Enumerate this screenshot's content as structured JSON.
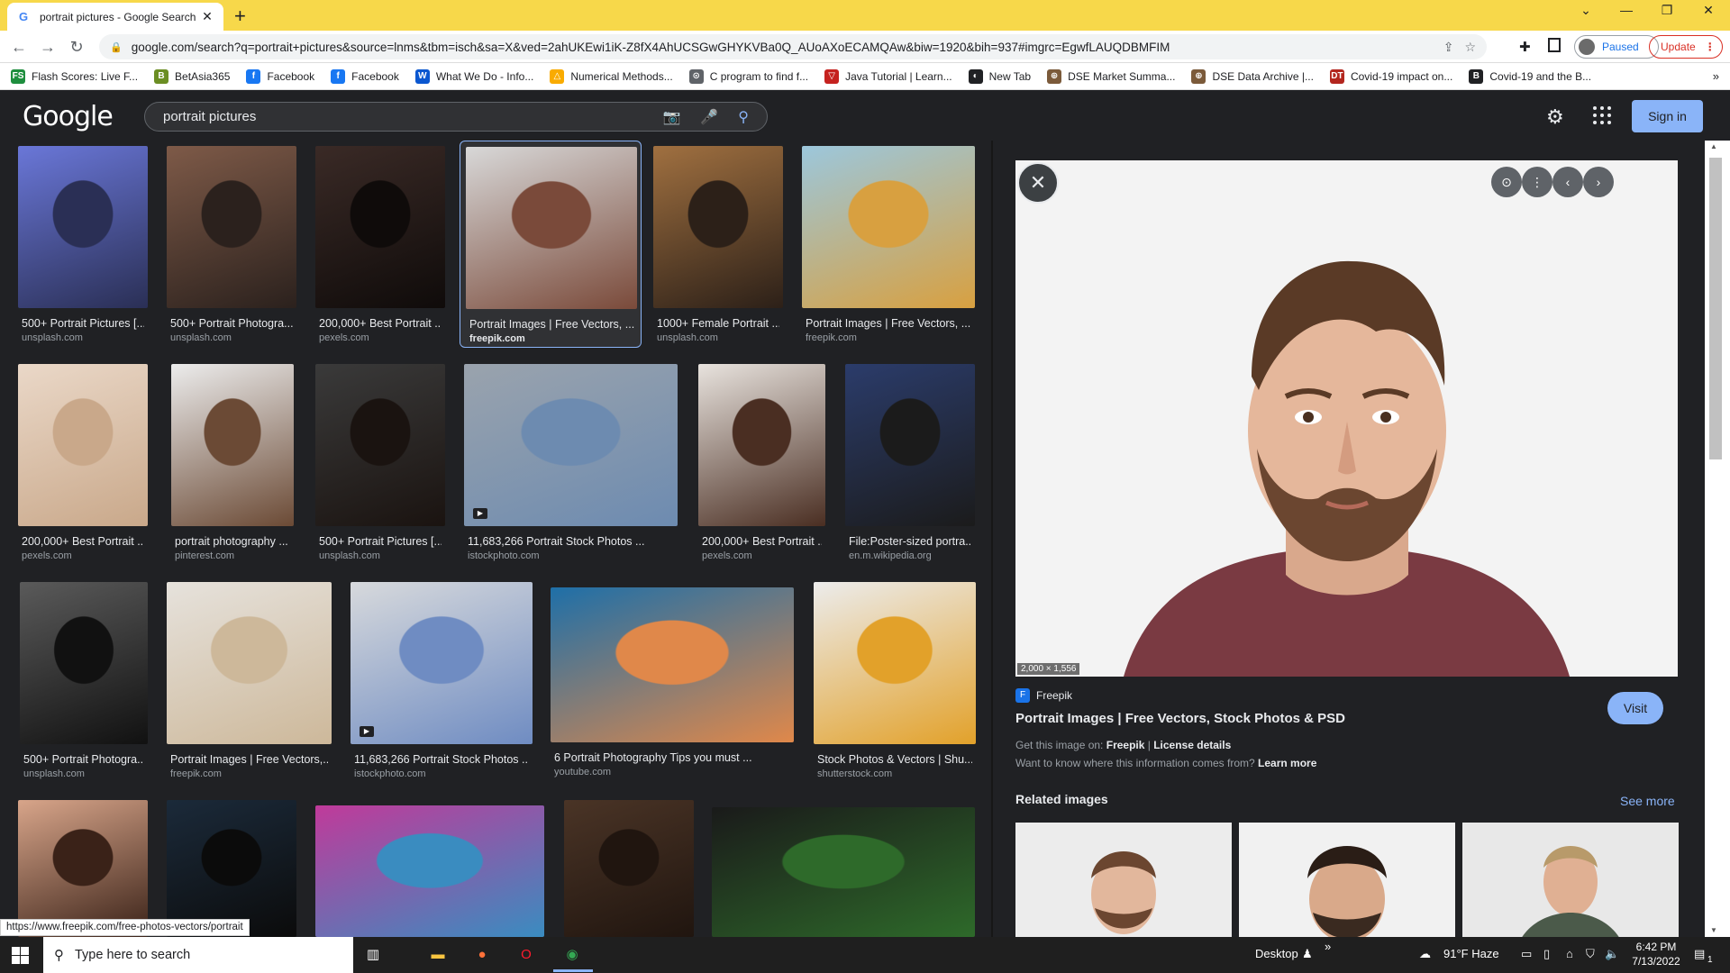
{
  "browser": {
    "tab_title": "portrait pictures - Google Search",
    "tab_favicon": "G",
    "url": "google.com/search?q=portrait+pictures&source=lnms&tbm=isch&sa=X&ved=2ahUKEwi1iK-Z8fX4AhUCSGwGHYKVBa0Q_AUoAXoECAMQAw&biw=1920&bih=937#imgrc=EgwfLAUQDBMFIM",
    "profile_label": "Paused",
    "update_label": "Update",
    "tabbar_color": "#f7d84a",
    "bookmarks": [
      {
        "label": "Flash Scores: Live F...",
        "icon": "FS",
        "color": "#1e8e3e"
      },
      {
        "label": "BetAsia365",
        "icon": "B",
        "color": "#6b8e23"
      },
      {
        "label": "Facebook",
        "icon": "f",
        "color": "#1877f2"
      },
      {
        "label": "Facebook",
        "icon": "f",
        "color": "#1877f2"
      },
      {
        "label": "What We Do - Info...",
        "icon": "W",
        "color": "#0b57d0"
      },
      {
        "label": "Numerical Methods...",
        "icon": "△",
        "color": "#f9ab00"
      },
      {
        "label": "C program to find f...",
        "icon": "⊙",
        "color": "#5f6368"
      },
      {
        "label": "Java Tutorial | Learn...",
        "icon": "▽",
        "color": "#c5221f"
      },
      {
        "label": "New Tab",
        "icon": "◐",
        "color": "#202124"
      },
      {
        "label": "DSE Market Summa...",
        "icon": "⊕",
        "color": "#7b5a3a"
      },
      {
        "label": "DSE Data Archive |...",
        "icon": "⊕",
        "color": "#7b5a3a"
      },
      {
        "label": "Covid-19 impact on...",
        "icon": "DT",
        "color": "#b3261e"
      },
      {
        "label": "Covid-19 and the B...",
        "icon": "B",
        "color": "#202124"
      }
    ]
  },
  "google": {
    "logo": "Google",
    "query": "portrait pictures",
    "signin_label": "Sign in",
    "results": [
      {
        "title": "500+ Portrait Pictures [...",
        "source": "unsplash.com",
        "colors": [
          "#6a77d8",
          "#2a2f55"
        ]
      },
      {
        "title": "500+ Portrait Photogra...",
        "source": "unsplash.com",
        "colors": [
          "#7e5a48",
          "#2b211d"
        ]
      },
      {
        "title": "200,000+ Best Portrait ...",
        "source": "pexels.com",
        "colors": [
          "#3a2a26",
          "#0f0b0a"
        ]
      },
      {
        "title": "Portrait Images | Free Vectors, ...",
        "source": "freepik.com",
        "colors": [
          "#d8d8d8",
          "#7a4a3a"
        ],
        "selected": true
      },
      {
        "title": "1000+ Female Portrait ...",
        "source": "unsplash.com",
        "colors": [
          "#a07040",
          "#2c2018"
        ]
      },
      {
        "title": "Portrait Images | Free Vectors, ...",
        "source": "freepik.com",
        "colors": [
          "#9cc7dc",
          "#d8a040"
        ]
      },
      {
        "title": "200,000+ Best Portrait ...",
        "source": "pexels.com",
        "colors": [
          "#ead8c8",
          "#c9a88a"
        ]
      },
      {
        "title": "portrait photography ...",
        "source": "pinterest.com",
        "colors": [
          "#ececec",
          "#6b4a35"
        ]
      },
      {
        "title": "500+ Portrait Pictures [...",
        "source": "unsplash.com",
        "colors": [
          "#3a3a3a",
          "#1a1310"
        ]
      },
      {
        "title": "11,683,266 Portrait Stock Photos ...",
        "source": "istockphoto.com",
        "colors": [
          "#9aa3ad",
          "#6d8bb0"
        ],
        "video": true
      },
      {
        "title": "200,000+ Best Portrait ...",
        "source": "pexels.com",
        "colors": [
          "#e8e3de",
          "#4a2e22"
        ]
      },
      {
        "title": "File:Poster-sized portra...",
        "source": "en.m.wikipedia.org",
        "colors": [
          "#2b3c6b",
          "#1b1b1b"
        ]
      },
      {
        "title": "500+ Portrait Photogra...",
        "source": "unsplash.com",
        "colors": [
          "#5a5a5a",
          "#111111"
        ]
      },
      {
        "title": "Portrait Images | Free Vectors,...",
        "source": "freepik.com",
        "colors": [
          "#e6e2dc",
          "#cdb89a"
        ]
      },
      {
        "title": "11,683,266 Portrait Stock Photos ...",
        "source": "istockphoto.com",
        "colors": [
          "#d7d9dc",
          "#6f8cc2"
        ],
        "video": true
      },
      {
        "title": "6 Portrait Photography Tips you must ...",
        "source": "youtube.com",
        "colors": [
          "#1e6fa8",
          "#e0884a"
        ]
      },
      {
        "title": "Stock Photos & Vectors | Shu...",
        "source": "shutterstock.com",
        "colors": [
          "#ececec",
          "#e2a12a"
        ]
      },
      {
        "title": "",
        "source": "",
        "colors": [
          "#d8a58a",
          "#3a2218"
        ]
      },
      {
        "title": "",
        "source": "",
        "colors": [
          "#1b2a3a",
          "#0b0b0b"
        ]
      },
      {
        "title": "",
        "source": "",
        "colors": [
          "#c03a9a",
          "#3a8cc0"
        ]
      },
      {
        "title": "",
        "source": "",
        "colors": [
          "#4a3426",
          "#20150f"
        ]
      },
      {
        "title": "",
        "source": "",
        "colors": [
          "#1a1a1a",
          "#2e6a2a"
        ]
      }
    ]
  },
  "preview": {
    "dimensions": "2,000 × 1,556",
    "site_name": "Freepik",
    "title": "Portrait Images | Free Vectors, Stock Photos & PSD",
    "visit_label": "Visit",
    "get_image_prefix": "Get this image on:",
    "get_image_site": "Freepik",
    "get_image_sep": " | ",
    "license_label": "License details",
    "want_text": "Want to know where this information comes from?",
    "learn_more": "Learn more",
    "related_heading": "Related images",
    "see_more": "See more"
  },
  "status_link": "https://www.freepik.com/free-photos-vectors/portrait",
  "taskbar": {
    "search_placeholder": "Type here to search",
    "desktop_label": "Desktop",
    "chevron": "»",
    "weather": "91°F  Haze",
    "time": "6:42 PM",
    "date": "7/13/2022",
    "notif_count": "1"
  }
}
